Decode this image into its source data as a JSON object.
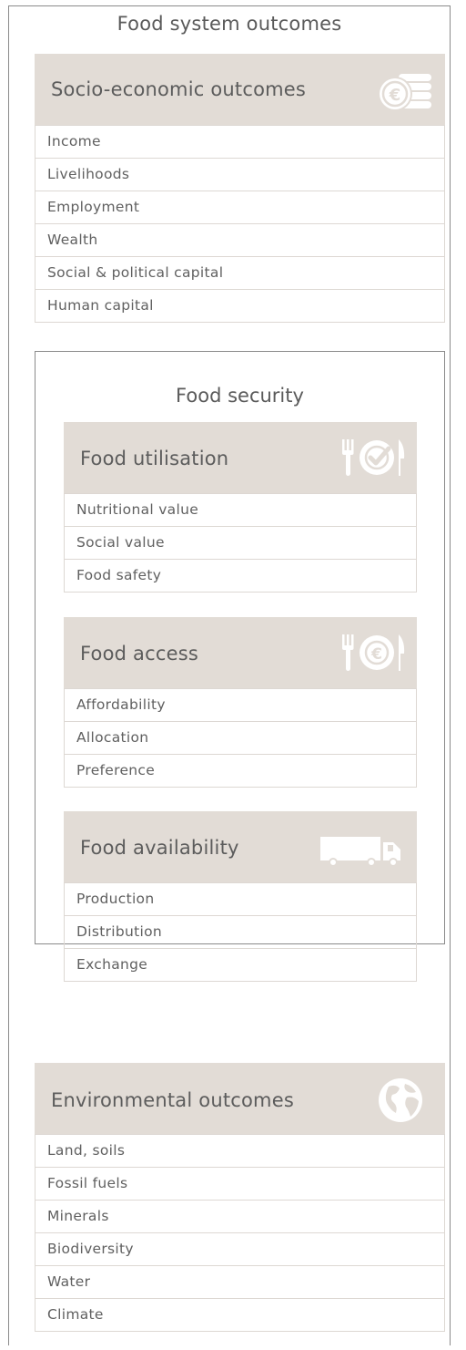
{
  "title": "Food system outcomes",
  "socio": {
    "title": "Socio-economic outcomes",
    "icon": "coins-euro-icon",
    "items": [
      "Income",
      "Livelihoods",
      "Employment",
      "Wealth",
      "Social & political capital",
      "Human capital"
    ]
  },
  "food_security": {
    "title": "Food security",
    "utilisation": {
      "title": "Food utilisation",
      "icon": "plate-check-cutlery-icon",
      "items": [
        "Nutritional value",
        "Social value",
        "Food safety"
      ]
    },
    "access": {
      "title": "Food access",
      "icon": "plate-euro-cutlery-icon",
      "items": [
        "Affordability",
        "Allocation",
        "Preference"
      ]
    },
    "availability": {
      "title": "Food availability",
      "icon": "truck-icon",
      "items": [
        "Production",
        "Distribution",
        "Exchange"
      ]
    }
  },
  "environmental": {
    "title": "Environmental outcomes",
    "icon": "globe-icon",
    "items": [
      "Land, soils",
      "Fossil fuels",
      "Minerals",
      "Biodiversity",
      "Water",
      "Climate"
    ]
  },
  "colors": {
    "header_bg": "#e2dcd6",
    "icon_fill": "#ffffff",
    "border": "#8a8a8a",
    "row_border": "#ddd8d3"
  }
}
